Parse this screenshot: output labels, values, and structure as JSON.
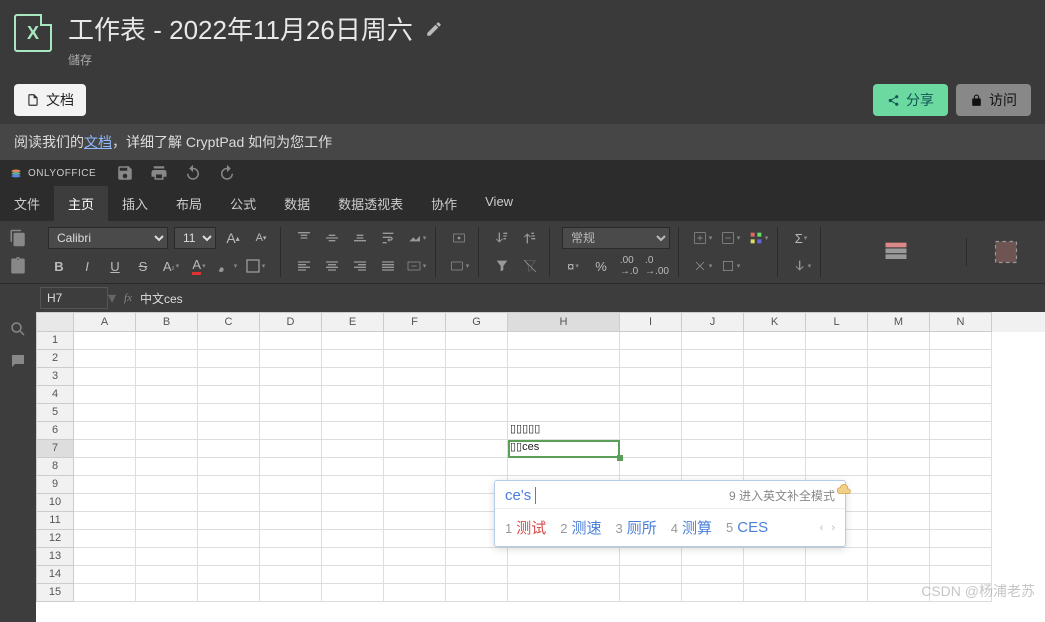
{
  "header": {
    "title": "工作表 - 2022年11月26日周六",
    "status": "儲存"
  },
  "toolbar": {
    "doc_btn": "文档",
    "share": "分享",
    "access": "访问"
  },
  "info": {
    "pre": "阅读我们的",
    "link": "文档",
    "post": "，详细了解 CryptPad 如何为您工作"
  },
  "oo": {
    "brand": "ONLYOFFICE"
  },
  "menu": {
    "file": "文件",
    "home": "主页",
    "insert": "插入",
    "layout": "布局",
    "formula": "公式",
    "data": "数据",
    "pivot": "数据透视表",
    "collab": "协作",
    "view": "View"
  },
  "ribbon": {
    "font_name": "Calibri",
    "font_size": "11",
    "number_format": "常规",
    "bold": "B",
    "italic": "I",
    "underline": "U",
    "strike": "S"
  },
  "fx": {
    "cell_ref": "H7",
    "label": "fx",
    "value": "中文ces"
  },
  "grid": {
    "cols": [
      "A",
      "B",
      "C",
      "D",
      "E",
      "F",
      "G",
      "H",
      "I",
      "J",
      "K",
      "L",
      "M",
      "N"
    ],
    "rows": [
      1,
      2,
      3,
      4,
      5,
      6,
      7,
      8,
      9,
      10,
      11,
      12,
      13,
      14,
      15
    ],
    "h6": "▯▯▯▯▯",
    "h7": "▯▯ces"
  },
  "ime": {
    "input": "ce's",
    "hint_num": "9",
    "hint": "进入英文补全模式",
    "candidates": [
      {
        "n": "1",
        "w": "测试"
      },
      {
        "n": "2",
        "w": "测速"
      },
      {
        "n": "3",
        "w": "厕所"
      },
      {
        "n": "4",
        "w": "测算"
      },
      {
        "n": "5",
        "w": "CES"
      }
    ]
  },
  "watermark": "CSDN @杨浦老苏"
}
